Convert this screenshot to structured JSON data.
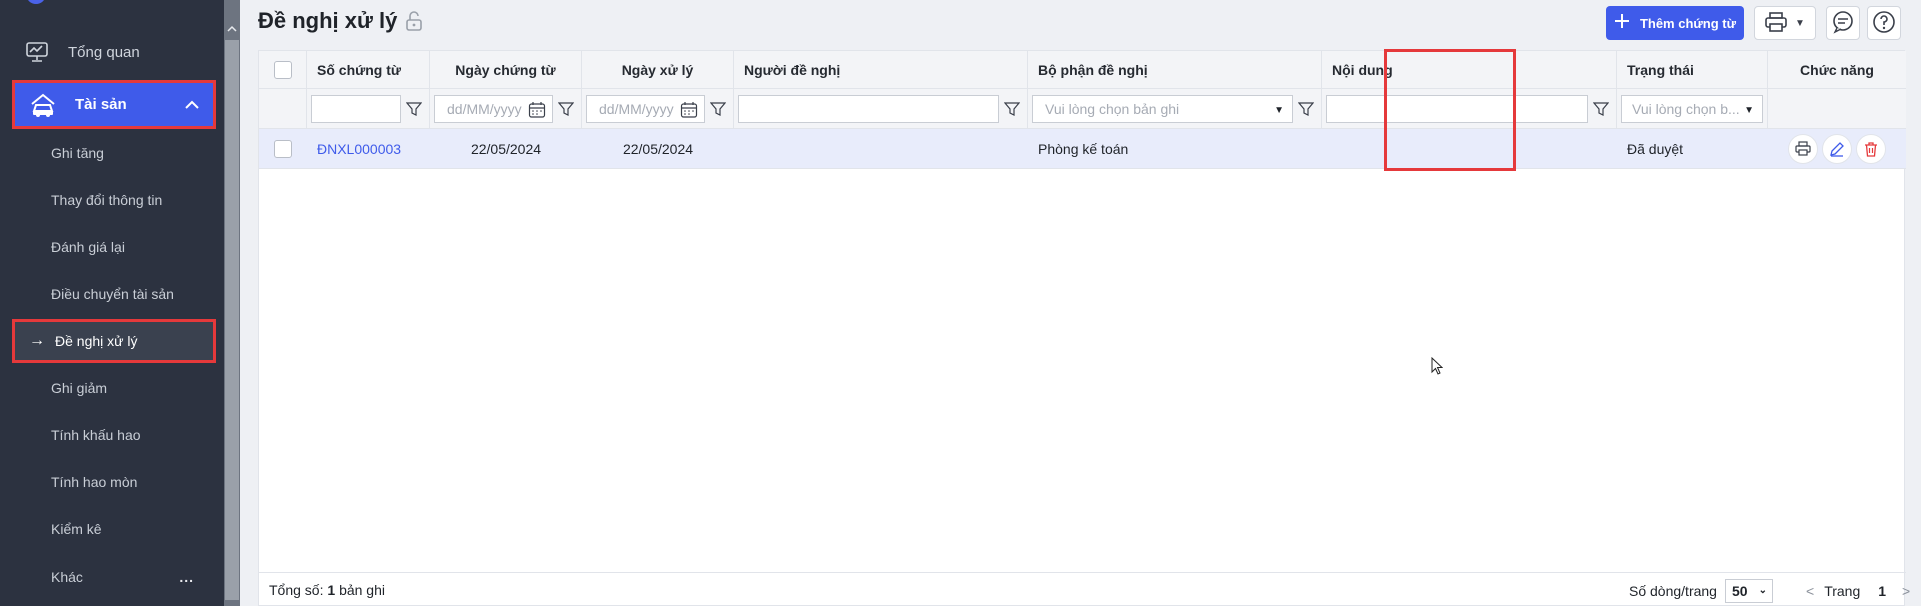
{
  "sidebar": {
    "top_item": {
      "label": "Tổng quan",
      "icon": "dashboard-icon"
    },
    "parent_item": {
      "label": "Tài sản",
      "icon": "asset-icon"
    },
    "sub_items": [
      {
        "label": "Ghi tăng"
      },
      {
        "label": "Thay đổi thông tin"
      },
      {
        "label": "Đánh giá lại"
      },
      {
        "label": "Điều chuyển tài sản"
      },
      {
        "label": "Đề nghị xử lý",
        "active": true
      },
      {
        "label": "Ghi giảm"
      },
      {
        "label": "Tính khấu hao"
      },
      {
        "label": "Tính hao mòn"
      },
      {
        "label": "Kiểm kê"
      },
      {
        "label": "Khác"
      }
    ],
    "more_label": "...",
    "active_arrow": "→"
  },
  "header": {
    "title": "Đề nghị xử lý",
    "add_button_label": "Thêm chứng từ"
  },
  "table": {
    "columns": [
      "Số chứng từ",
      "Ngày chứng từ",
      "Ngày xử lý",
      "Người đề nghị",
      "Bộ phận đề nghị",
      "Nội dung",
      "Trạng thái",
      "Chức năng"
    ],
    "filters": {
      "date_placeholder": "dd/MM/yyyy",
      "department_placeholder": "Vui lòng chọn bản ghi",
      "status_placeholder": "Vui lòng chọn b..."
    },
    "rows": [
      {
        "doc_no": "ĐNXL000003",
        "doc_date": "22/05/2024",
        "process_date": "22/05/2024",
        "requester": "",
        "department": "Phòng kế toán",
        "content": "",
        "status": "Đã duyệt"
      }
    ]
  },
  "footer": {
    "total_label": "Tổng số:",
    "total_count": "1",
    "total_unit": "bản ghi",
    "rows_per_page_label": "Số dòng/trang",
    "rows_per_page": "50",
    "prev": "<",
    "page_label": "Trang",
    "page": "1",
    "next": ">"
  },
  "colors": {
    "accent": "#3f5bea",
    "highlight": "#e5393b",
    "sidebar_bg": "#2c3240",
    "selected_row": "#e8ecfb"
  }
}
